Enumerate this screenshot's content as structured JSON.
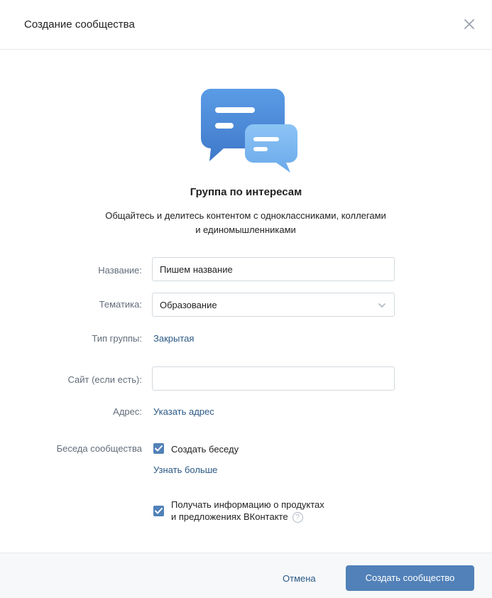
{
  "header": {
    "title": "Создание сообщества",
    "close_icon": "close-icon"
  },
  "hero": {
    "icon": "chat-bubbles-icon",
    "title": "Группа по интересам",
    "description": "Общайтесь и делитесь контентом с одноклассниками, коллегами и единомышленниками"
  },
  "form": {
    "name_label": "Название:",
    "name_value": "Пишем название",
    "topic_label": "Тематика:",
    "topic_value": "Образование",
    "type_label": "Тип группы:",
    "type_value": "Закрытая",
    "site_label": "Сайт (если есть):",
    "site_value": "",
    "address_label": "Адрес:",
    "address_link": "Указать адрес",
    "chat_label": "Беседа сообщества",
    "chat_checkbox_label": "Создать беседу",
    "chat_checked": true,
    "learn_more": "Узнать больше",
    "promo_label_line1": "Получать информацию о продуктах",
    "promo_label_line2": "и предложениях ВКонтакте",
    "promo_checked": true,
    "help_glyph": "?"
  },
  "footer": {
    "cancel_label": "Отмена",
    "create_label": "Создать сообщество"
  },
  "colors": {
    "accent": "#5181b8",
    "link": "#2a5885",
    "label": "#626d7a"
  }
}
